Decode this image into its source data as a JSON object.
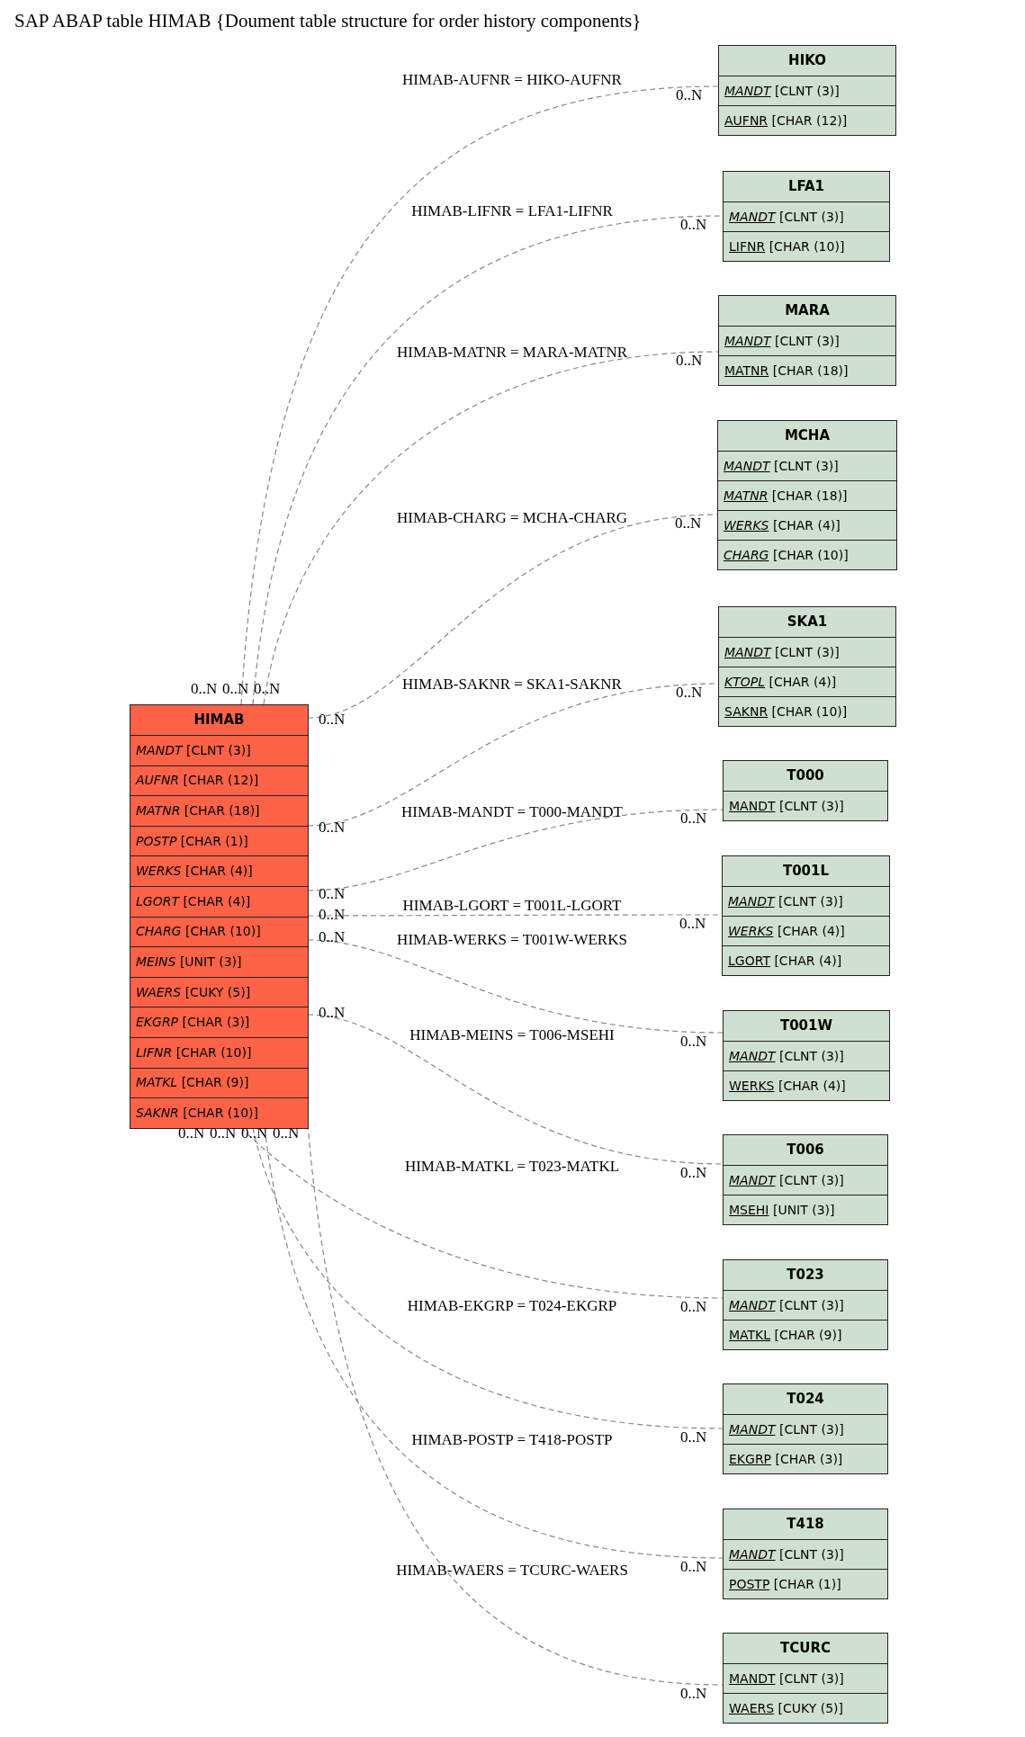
{
  "title": "SAP ABAP table HIMAB {Doument table structure for order history components}",
  "main_table": {
    "name": "HIMAB",
    "fields": [
      {
        "name": "MANDT",
        "type": "[CLNT (3)]",
        "kind": "foreign"
      },
      {
        "name": "AUFNR",
        "type": "[CHAR (12)]",
        "kind": "foreign"
      },
      {
        "name": "MATNR",
        "type": "[CHAR (18)]",
        "kind": "foreign"
      },
      {
        "name": "POSTP",
        "type": "[CHAR (1)]",
        "kind": "foreign"
      },
      {
        "name": "WERKS",
        "type": "[CHAR (4)]",
        "kind": "foreign"
      },
      {
        "name": "LGORT",
        "type": "[CHAR (4)]",
        "kind": "foreign"
      },
      {
        "name": "CHARG",
        "type": "[CHAR (10)]",
        "kind": "foreign"
      },
      {
        "name": "MEINS",
        "type": "[UNIT (3)]",
        "kind": "foreign"
      },
      {
        "name": "WAERS",
        "type": "[CUKY (5)]",
        "kind": "foreign"
      },
      {
        "name": "EKGRP",
        "type": "[CHAR (3)]",
        "kind": "foreign"
      },
      {
        "name": "LIFNR",
        "type": "[CHAR (10)]",
        "kind": "foreign"
      },
      {
        "name": "MATKL",
        "type": "[CHAR (9)]",
        "kind": "foreign"
      },
      {
        "name": "SAKNR",
        "type": "[CHAR (10)]",
        "kind": "foreign"
      }
    ]
  },
  "related_tables": [
    {
      "name": "HIKO",
      "relation": "HIMAB-AUFNR = HIKO-AUFNR",
      "cardinality_left": "0..N",
      "cardinality_right": "0..N",
      "fields": [
        {
          "name": "MANDT",
          "type": "[CLNT (3)]",
          "kind": "foreign_key"
        },
        {
          "name": "AUFNR",
          "type": "[CHAR (12)]",
          "kind": "key"
        }
      ]
    },
    {
      "name": "LFA1",
      "relation": "HIMAB-LIFNR = LFA1-LIFNR",
      "cardinality_left": "0..N",
      "cardinality_right": "0..N",
      "fields": [
        {
          "name": "MANDT",
          "type": "[CLNT (3)]",
          "kind": "foreign_key"
        },
        {
          "name": "LIFNR",
          "type": "[CHAR (10)]",
          "kind": "key"
        }
      ]
    },
    {
      "name": "MARA",
      "relation": "HIMAB-MATNR = MARA-MATNR",
      "cardinality_left": "0..N",
      "cardinality_right": "0..N",
      "fields": [
        {
          "name": "MANDT",
          "type": "[CLNT (3)]",
          "kind": "foreign_key"
        },
        {
          "name": "MATNR",
          "type": "[CHAR (18)]",
          "kind": "key"
        }
      ]
    },
    {
      "name": "MCHA",
      "relation": "HIMAB-CHARG = MCHA-CHARG",
      "cardinality_left": "0..N",
      "cardinality_right": "0..N",
      "fields": [
        {
          "name": "MANDT",
          "type": "[CLNT (3)]",
          "kind": "foreign_key"
        },
        {
          "name": "MATNR",
          "type": "[CHAR (18)]",
          "kind": "foreign_key"
        },
        {
          "name": "WERKS",
          "type": "[CHAR (4)]",
          "kind": "foreign_key"
        },
        {
          "name": "CHARG",
          "type": "[CHAR (10)]",
          "kind": "foreign_key"
        }
      ]
    },
    {
      "name": "SKA1",
      "relation": "HIMAB-SAKNR = SKA1-SAKNR",
      "cardinality_left": "0..N",
      "cardinality_right": "0..N",
      "fields": [
        {
          "name": "MANDT",
          "type": "[CLNT (3)]",
          "kind": "foreign_key"
        },
        {
          "name": "KTOPL",
          "type": "[CHAR (4)]",
          "kind": "foreign_key"
        },
        {
          "name": "SAKNR",
          "type": "[CHAR (10)]",
          "kind": "key"
        }
      ]
    },
    {
      "name": "T000",
      "relation": "HIMAB-MANDT = T000-MANDT",
      "cardinality_left": "0..N",
      "cardinality_right": "0..N",
      "fields": [
        {
          "name": "MANDT",
          "type": "[CLNT (3)]",
          "kind": "key"
        }
      ]
    },
    {
      "name": "T001L",
      "relation": "HIMAB-LGORT = T001L-LGORT",
      "cardinality_left": "0..N",
      "cardinality_right": "0..N",
      "fields": [
        {
          "name": "MANDT",
          "type": "[CLNT (3)]",
          "kind": "foreign_key"
        },
        {
          "name": "WERKS",
          "type": "[CHAR (4)]",
          "kind": "foreign_key"
        },
        {
          "name": "LGORT",
          "type": "[CHAR (4)]",
          "kind": "key"
        }
      ]
    },
    {
      "name": "T001W",
      "relation": "HIMAB-WERKS = T001W-WERKS",
      "cardinality_left": "0..N",
      "cardinality_right": "0..N",
      "fields": [
        {
          "name": "MANDT",
          "type": "[CLNT (3)]",
          "kind": "foreign_key"
        },
        {
          "name": "WERKS",
          "type": "[CHAR (4)]",
          "kind": "key"
        }
      ]
    },
    {
      "name": "T006",
      "relation": "HIMAB-MEINS = T006-MSEHI",
      "cardinality_left": "0..N",
      "cardinality_right": "0..N",
      "fields": [
        {
          "name": "MANDT",
          "type": "[CLNT (3)]",
          "kind": "foreign_key"
        },
        {
          "name": "MSEHI",
          "type": "[UNIT (3)]",
          "kind": "key"
        }
      ]
    },
    {
      "name": "T023",
      "relation": "HIMAB-MATKL = T023-MATKL",
      "cardinality_left": "0..N",
      "cardinality_right": "0..N",
      "fields": [
        {
          "name": "MANDT",
          "type": "[CLNT (3)]",
          "kind": "foreign_key"
        },
        {
          "name": "MATKL",
          "type": "[CHAR (9)]",
          "kind": "key"
        }
      ]
    },
    {
      "name": "T024",
      "relation": "HIMAB-EKGRP = T024-EKGRP",
      "cardinality_left": "0..N",
      "cardinality_right": "0..N",
      "fields": [
        {
          "name": "MANDT",
          "type": "[CLNT (3)]",
          "kind": "foreign_key"
        },
        {
          "name": "EKGRP",
          "type": "[CHAR (3)]",
          "kind": "key"
        }
      ]
    },
    {
      "name": "T418",
      "relation": "HIMAB-POSTP = T418-POSTP",
      "cardinality_left": "0..N",
      "cardinality_right": "0..N",
      "fields": [
        {
          "name": "MANDT",
          "type": "[CLNT (3)]",
          "kind": "foreign_key"
        },
        {
          "name": "POSTP",
          "type": "[CHAR (1)]",
          "kind": "key"
        }
      ]
    },
    {
      "name": "TCURC",
      "relation": "HIMAB-WAERS = TCURC-WAERS",
      "cardinality_left": "0..N",
      "cardinality_right": "0..N",
      "fields": [
        {
          "name": "MANDT",
          "type": "[CLNT (3)]",
          "kind": "key"
        },
        {
          "name": "WAERS",
          "type": "[CUKY (5)]",
          "kind": "key"
        }
      ]
    }
  ]
}
